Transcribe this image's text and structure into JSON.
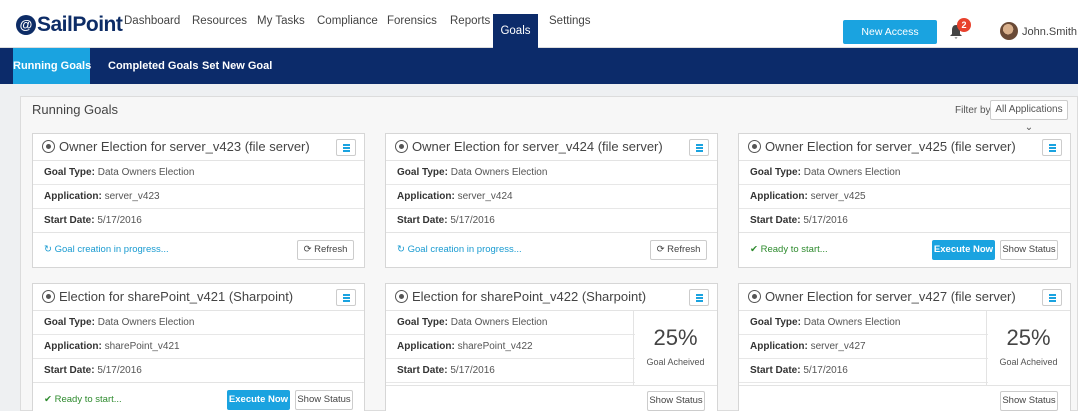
{
  "brand": {
    "logo_mark": "@",
    "logo_text": "SailPoint"
  },
  "nav": {
    "items": [
      "Dashboard",
      "Resources",
      "My Tasks",
      "Compliance",
      "Forensics",
      "Reports",
      "Goals",
      "Settings"
    ],
    "active": "Goals"
  },
  "header": {
    "new_access_label": "New Access Request",
    "notification_count": "2",
    "user_name": "John.Smith"
  },
  "subnav": {
    "items": [
      "Running Goals",
      "Completed Goals",
      "Set New Goal"
    ],
    "active": "Running Goals"
  },
  "panel": {
    "title": "Running Goals",
    "filter_label": "Filter by:",
    "filter_value": "All Applications"
  },
  "labels": {
    "goal_type": "Goal Type:",
    "application": "Application:",
    "start_date": "Start Date:",
    "refresh": "Refresh",
    "execute": "Execute Now",
    "show_status": "Show Status",
    "goal_achieved": "Goal Acheived"
  },
  "cards": [
    {
      "title": "Owner Election for server_v423 (file server)",
      "goal_type": "Data Owners Election",
      "application": "server_v423",
      "start_date": "5/17/2016",
      "status": "Goal creation in progress..."
    },
    {
      "title": "Owner Election for server_v424 (file server)",
      "goal_type": "Data Owners Election",
      "application": "server_v424",
      "start_date": "5/17/2016",
      "status": "Goal creation in progress..."
    },
    {
      "title": "Owner Election for server_v425 (file server)",
      "goal_type": "Data Owners Election",
      "application": "server_v425",
      "start_date": "5/17/2016",
      "status": "Ready to start..."
    },
    {
      "title": "Election for sharePoint_v421 (Sharpoint)",
      "goal_type": "Data Owners Election",
      "application": "sharePoint_v421",
      "start_date": "5/17/2016",
      "status": "Ready to start..."
    },
    {
      "title": "Election for sharePoint_v422 (Sharpoint)",
      "goal_type": "Data Owners Election",
      "application": "sharePoint_v422",
      "start_date": "5/17/2016",
      "progress": "25%"
    },
    {
      "title": "Owner Election for server_v427 (file server)",
      "goal_type": "Data Owners Election",
      "application": "server_v427",
      "start_date": "5/17/2016",
      "progress": "25%"
    }
  ],
  "colors": {
    "navy": "#0c2b6a",
    "accent": "#1aa3e0",
    "ready_green": "#2e8b2e",
    "badge_red": "#e8412c"
  }
}
